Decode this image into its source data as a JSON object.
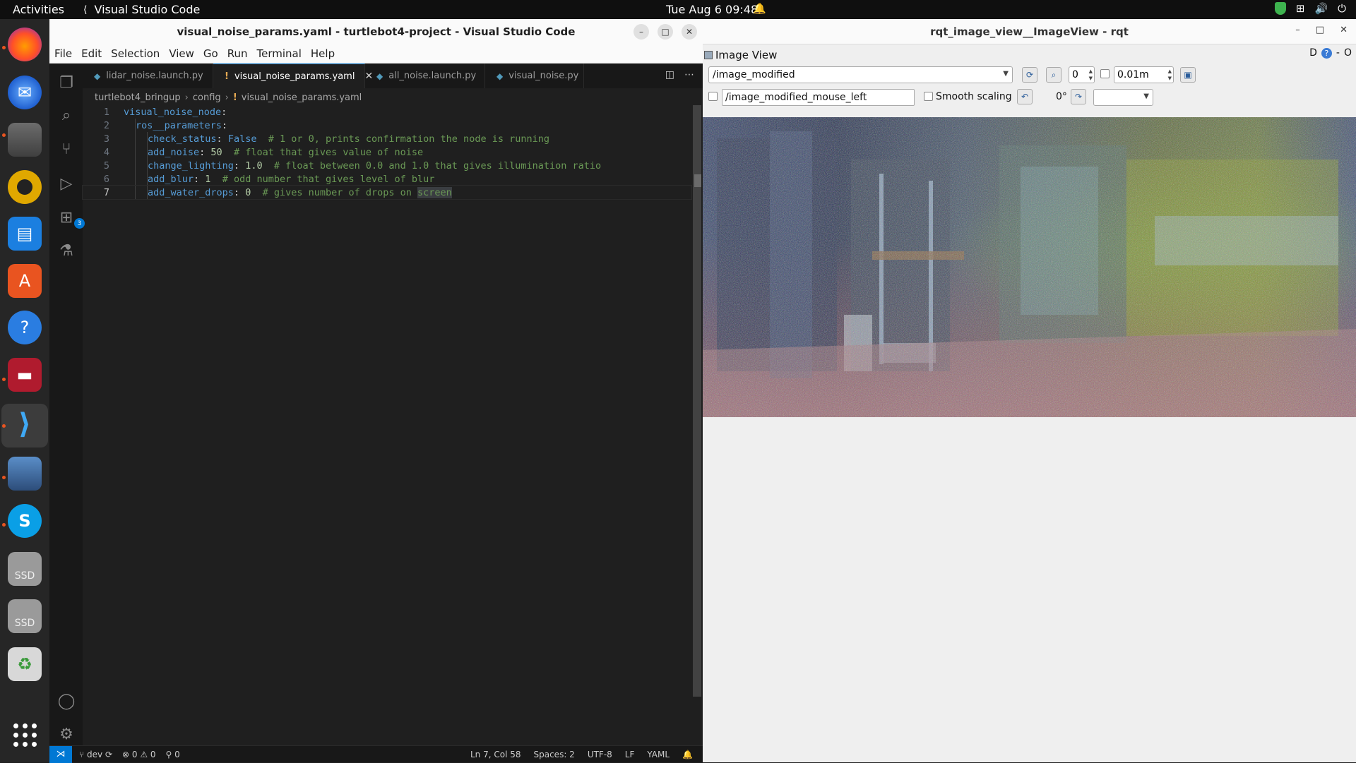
{
  "topbar": {
    "activities": "Activities",
    "app_name": "Visual Studio Code",
    "clock": "Tue Aug 6  09:48"
  },
  "dock": {
    "items": [
      "firefox-icon",
      "thunderbird-icon",
      "files-icon",
      "rhythmbox-icon",
      "writer-icon",
      "app-center-icon",
      "help-icon",
      "terminal-icon",
      "vscode-icon",
      "image-viewer-icon",
      "skype-icon",
      "ssd-drive-icon",
      "ssd-drive-icon",
      "trash-icon",
      "show-apps-icon"
    ],
    "ssd_label": "SSD",
    "help_glyph": "?",
    "skype_glyph": "S"
  },
  "vscode": {
    "title": "visual_noise_params.yaml - turtlebot4-project - Visual Studio Code",
    "menu": [
      "File",
      "Edit",
      "Selection",
      "View",
      "Go",
      "Run",
      "Terminal",
      "Help"
    ],
    "tabs": [
      {
        "label": "lidar_noise.launch.py",
        "active": false
      },
      {
        "label": "visual_noise_params.yaml",
        "active": true
      },
      {
        "label": "all_noise.launch.py",
        "active": false
      },
      {
        "label": "visual_noise.py",
        "active": false
      }
    ],
    "extensions_badge": "3",
    "breadcrumb": [
      "turtlebot4_bringup",
      "config",
      "visual_noise_params.yaml"
    ],
    "lines": [
      {
        "num": "1",
        "key": "visual_noise_node",
        "value": "",
        "comment": ""
      },
      {
        "num": "2",
        "key": "ros__parameters",
        "value": "",
        "comment": ""
      },
      {
        "num": "3",
        "key": "check_status",
        "value": "False",
        "comment": "# 1 or 0, prints confirmation the node is running"
      },
      {
        "num": "4",
        "key": "add_noise",
        "value": "50",
        "comment": "# float that gives value of noise"
      },
      {
        "num": "5",
        "key": "change_lighting",
        "value": "1.0",
        "comment": "# float between 0.0 and 1.0 that gives illumination ratio"
      },
      {
        "num": "6",
        "key": "add_blur",
        "value": "1",
        "comment": "# odd number that gives level of blur"
      },
      {
        "num": "7",
        "key": "add_water_drops",
        "value": "0",
        "comment": "# gives number of drops on ",
        "highlight": "screen"
      }
    ],
    "status": {
      "branch": "dev",
      "errors": "0",
      "warnings": "0",
      "ports": "0",
      "position": "Ln 7, Col 58",
      "spaces": "Spaces: 2",
      "encoding": "UTF-8",
      "eol": "LF",
      "language": "YAML"
    }
  },
  "rqt": {
    "title": "rqt_image_view__ImageView - rqt",
    "plugin_title": "Image View",
    "plugin_right": "D",
    "plugin_close": "O",
    "topic": "/image_modified",
    "zoom_value": "0",
    "rate_value": "0.01m",
    "mouse_topic": "/image_modified_mouse_left",
    "smooth_scaling": "Smooth scaling",
    "rotation": "0°"
  }
}
